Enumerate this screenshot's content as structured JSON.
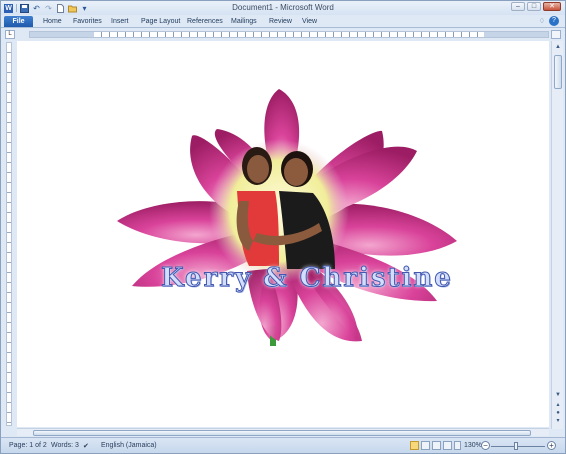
{
  "window": {
    "title": "Document1 - Microsoft Word",
    "controls": {
      "minimize": "–",
      "maximize": "□",
      "close": "✕"
    }
  },
  "quick_access": {
    "icons": [
      "word-app-icon",
      "save-icon",
      "undo-icon",
      "redo-icon",
      "new-document-icon",
      "open-folder-icon",
      "customize-icon"
    ]
  },
  "ribbon": {
    "tabs": [
      {
        "label": "File"
      },
      {
        "label": "Home"
      },
      {
        "label": "Favorites"
      },
      {
        "label": "Insert"
      },
      {
        "label": "Page Layout"
      },
      {
        "label": "References"
      },
      {
        "label": "Mailings"
      },
      {
        "label": "Review"
      },
      {
        "label": "View"
      }
    ],
    "help": "?"
  },
  "document": {
    "wordart": "Kerry & Christine",
    "colors": {
      "petal": "#cc2f82",
      "petal_light": "#f08ac0",
      "glow": "#f4f0a8",
      "wordart_fill": "#c9d7ff",
      "wordart_stroke": "#4a5fb8"
    }
  },
  "statusbar": {
    "page": "Page: 1 of 2",
    "words": "Words: 3",
    "language": "English (Jamaica)",
    "zoom": "130%",
    "zoom_minus": "−",
    "zoom_plus": "+"
  },
  "colors": {
    "accent": "#2b579a",
    "chrome": "#dfe9f5"
  }
}
